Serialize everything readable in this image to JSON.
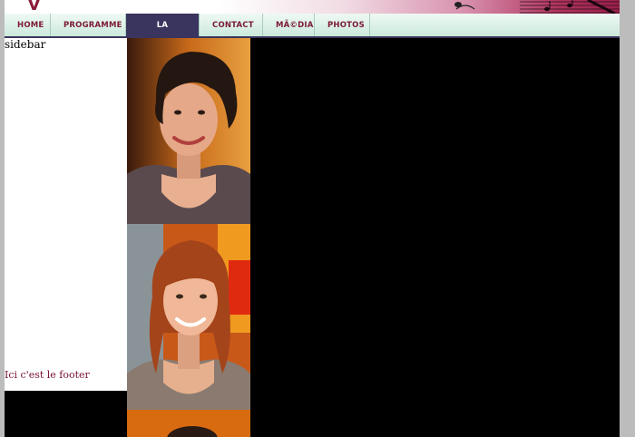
{
  "nav": {
    "items": [
      {
        "label": "HOME",
        "active": false
      },
      {
        "label": "PROGRAMME",
        "active": false
      },
      {
        "label": "LA CHORALE",
        "active": true
      },
      {
        "label": "CONTACT",
        "active": false
      },
      {
        "label": "MÃ©DIA",
        "active": false
      },
      {
        "label": "PHOTOS",
        "active": false
      }
    ]
  },
  "sidebar": {
    "title": "sidebar",
    "footer": "Ici c'est le footer"
  },
  "colors": {
    "nav_active_bg": "#39355e",
    "nav_text": "#7a1a33",
    "footer_text": "#7a1030",
    "brand": "#9a1f4b"
  },
  "icons": {
    "logo": "v-logo",
    "banner_art": "music-notes-art"
  }
}
